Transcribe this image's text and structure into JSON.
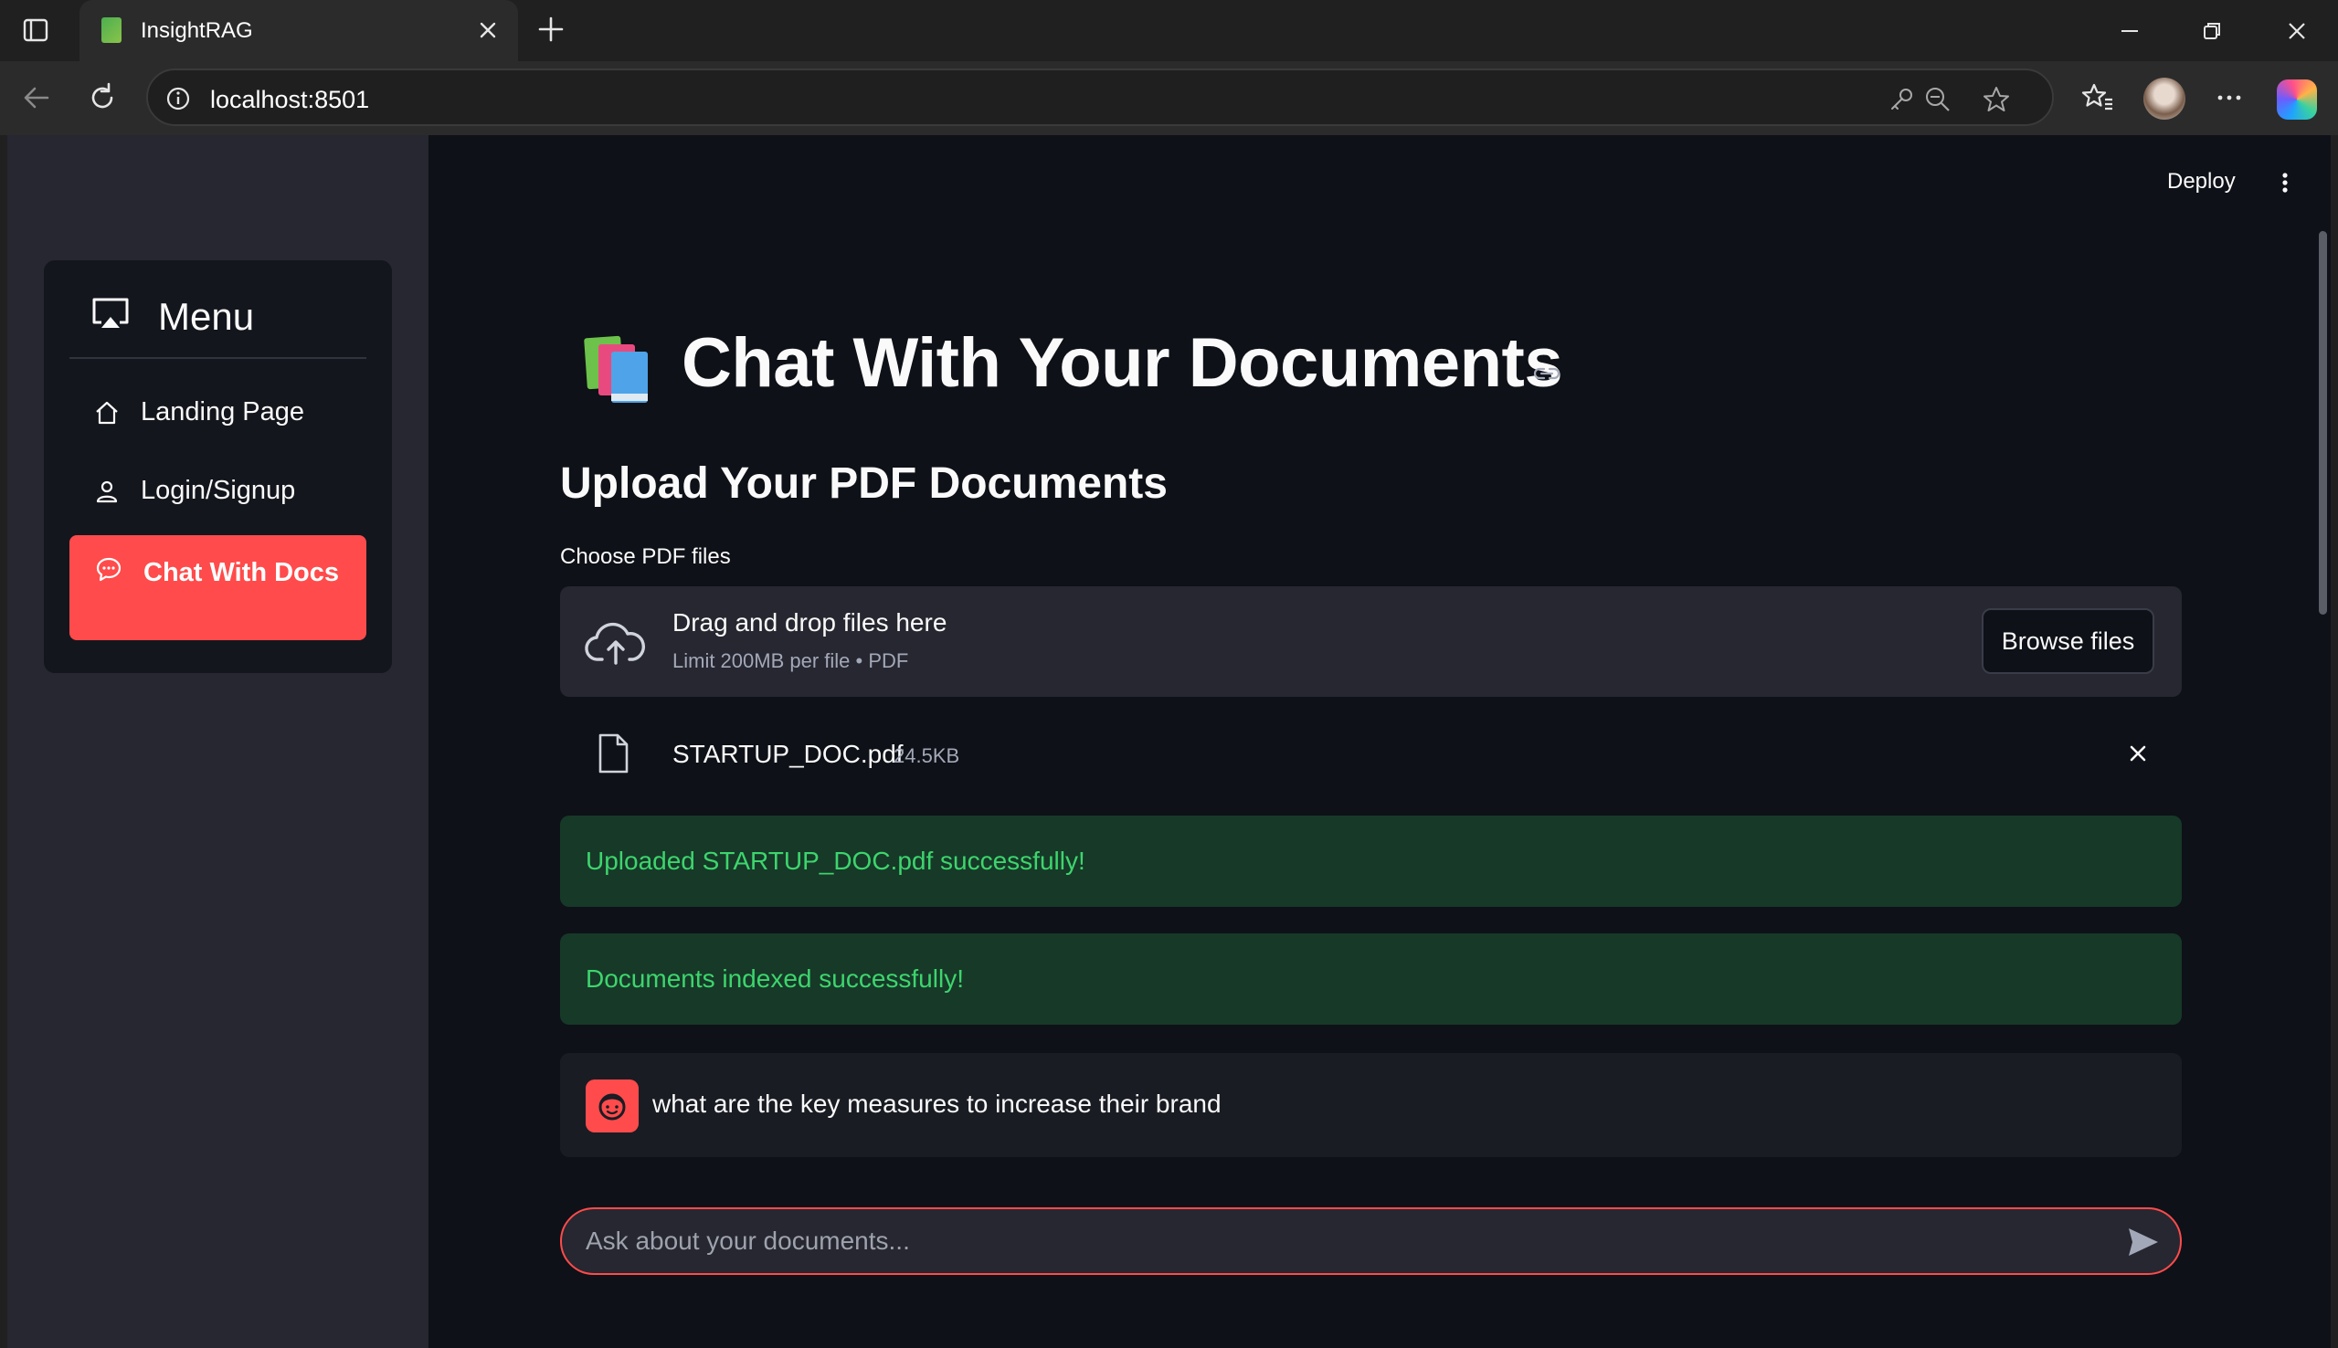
{
  "browser": {
    "tab_title": "InsightRAG",
    "url": "localhost:8501"
  },
  "sidebar": {
    "menu_title": "Menu",
    "items": [
      {
        "label": "Landing Page",
        "icon": "home-icon",
        "active": false
      },
      {
        "label": "Login/Signup",
        "icon": "user-icon",
        "active": false
      },
      {
        "label": "Chat With Docs",
        "icon": "chat-icon",
        "active": true
      }
    ]
  },
  "header": {
    "deploy_label": "Deploy"
  },
  "main": {
    "title": "Chat With Your Documents",
    "upload_heading": "Upload Your PDF Documents",
    "uploader": {
      "label": "Choose PDF files",
      "dropzone_title": "Drag and drop files here",
      "dropzone_subtitle": "Limit 200MB per file • PDF",
      "browse_label": "Browse files"
    },
    "uploaded_file": {
      "name": "STARTUP_DOC.pdf",
      "size": "24.5KB"
    },
    "alerts": [
      "Uploaded STARTUP_DOC.pdf successfully!",
      "Documents indexed successfully!"
    ],
    "chat_message": "what are the key measures to increase their brand",
    "chat_input_placeholder": "Ask about your documents..."
  },
  "colors": {
    "accent": "#ff4b4b",
    "success_bg": "#173928",
    "success_text": "#3dd56d",
    "app_bg": "#0e1117",
    "sidebar_bg": "#262730"
  }
}
